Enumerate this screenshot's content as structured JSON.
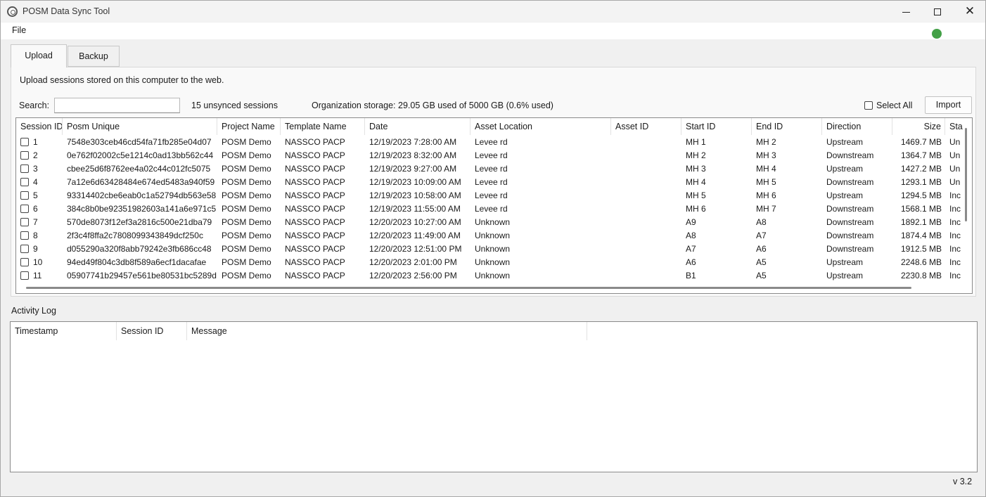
{
  "window": {
    "title": "POSM Data Sync Tool"
  },
  "menu": {
    "file": "File"
  },
  "status": {
    "color": "#43a047",
    "icon": "status-dot"
  },
  "tabs": [
    {
      "label": "Upload",
      "active": true
    },
    {
      "label": "Backup",
      "active": false
    }
  ],
  "upload": {
    "description": "Upload sessions stored on this computer to the web.",
    "search_label": "Search:",
    "search_value": "",
    "unsynced": "15 unsynced sessions",
    "storage": "Organization storage: 29.05 GB used of 5000 GB (0.6% used)",
    "select_all": "Select All",
    "import": "Import",
    "columns": [
      "Session ID",
      "Posm Unique",
      "Project Name",
      "Template Name",
      "Date",
      "Asset Location",
      "Asset ID",
      "Start ID",
      "End ID",
      "Direction",
      "Size",
      "Sta"
    ],
    "rows": [
      [
        "1",
        "7548e303ceb46cd54fa71fb285e04d07",
        "POSM Demo",
        "NASSCO PACP",
        "12/19/2023 7:28:00 AM",
        "Levee rd",
        "",
        "MH 1",
        "MH 2",
        "Upstream",
        "1469.7 MB",
        "Un"
      ],
      [
        "2",
        "0e762f02002c5e1214c0ad13bb562c44",
        "POSM Demo",
        "NASSCO PACP",
        "12/19/2023 8:32:00 AM",
        "Levee rd",
        "",
        "MH 2",
        "MH 3",
        "Downstream",
        "1364.7 MB",
        "Un"
      ],
      [
        "3",
        "cbee25d6f8762ee4a02c44c012fc5075",
        "POSM Demo",
        "NASSCO PACP",
        "12/19/2023 9:27:00 AM",
        "Levee rd",
        "",
        "MH 3",
        "MH 4",
        "Upstream",
        "1427.2 MB",
        "Un"
      ],
      [
        "4",
        "7a12e6d63428484e674ed5483a940f59",
        "POSM Demo",
        "NASSCO PACP",
        "12/19/2023 10:09:00 AM",
        "Levee rd",
        "",
        "MH 4",
        "MH 5",
        "Downstream",
        "1293.1 MB",
        "Un"
      ],
      [
        "5",
        "93314402cbe6eab0c1a52794db563e58",
        "POSM Demo",
        "NASSCO PACP",
        "12/19/2023 10:58:00 AM",
        "Levee rd",
        "",
        "MH 5",
        "MH 6",
        "Upstream",
        "1294.5 MB",
        "Inc"
      ],
      [
        "6",
        "384c8b0be92351982603a141a6e971c5",
        "POSM Demo",
        "NASSCO PACP",
        "12/19/2023 11:55:00 AM",
        "Levee rd",
        "",
        "MH 6",
        "MH 7",
        "Downstream",
        "1568.1 MB",
        "Inc"
      ],
      [
        "7",
        "570de8073f12ef3a2816c500e21dba79",
        "POSM Demo",
        "NASSCO PACP",
        "12/20/2023 10:27:00 AM",
        "Unknown",
        "",
        "A9",
        "A8",
        "Downstream",
        "1892.1 MB",
        "Inc"
      ],
      [
        "8",
        "2f3c4f8ffa2c7808099343849dcf250c",
        "POSM Demo",
        "NASSCO PACP",
        "12/20/2023 11:49:00 AM",
        "Unknown",
        "",
        "A8",
        "A7",
        "Downstream",
        "1874.4 MB",
        "Inc"
      ],
      [
        "9",
        "d055290a320f8abb79242e3fb686cc48",
        "POSM Demo",
        "NASSCO PACP",
        "12/20/2023 12:51:00 PM",
        "Unknown",
        "",
        "A7",
        "A6",
        "Downstream",
        "1912.5 MB",
        "Inc"
      ],
      [
        "10",
        "94ed49f804c3db8f589a6ecf1dacafae",
        "POSM Demo",
        "NASSCO PACP",
        "12/20/2023 2:01:00 PM",
        "Unknown",
        "",
        "A6",
        "A5",
        "Upstream",
        "2248.6 MB",
        "Inc"
      ],
      [
        "11",
        "05907741b29457e561be80531bc5289d",
        "POSM Demo",
        "NASSCO PACP",
        "12/20/2023 2:56:00 PM",
        "Unknown",
        "",
        "B1",
        "A5",
        "Upstream",
        "2230.8 MB",
        "Inc"
      ]
    ]
  },
  "activity_log": {
    "label": "Activity Log",
    "columns": [
      "Timestamp",
      "Session ID",
      "Message"
    ]
  },
  "version": "v 3.2"
}
